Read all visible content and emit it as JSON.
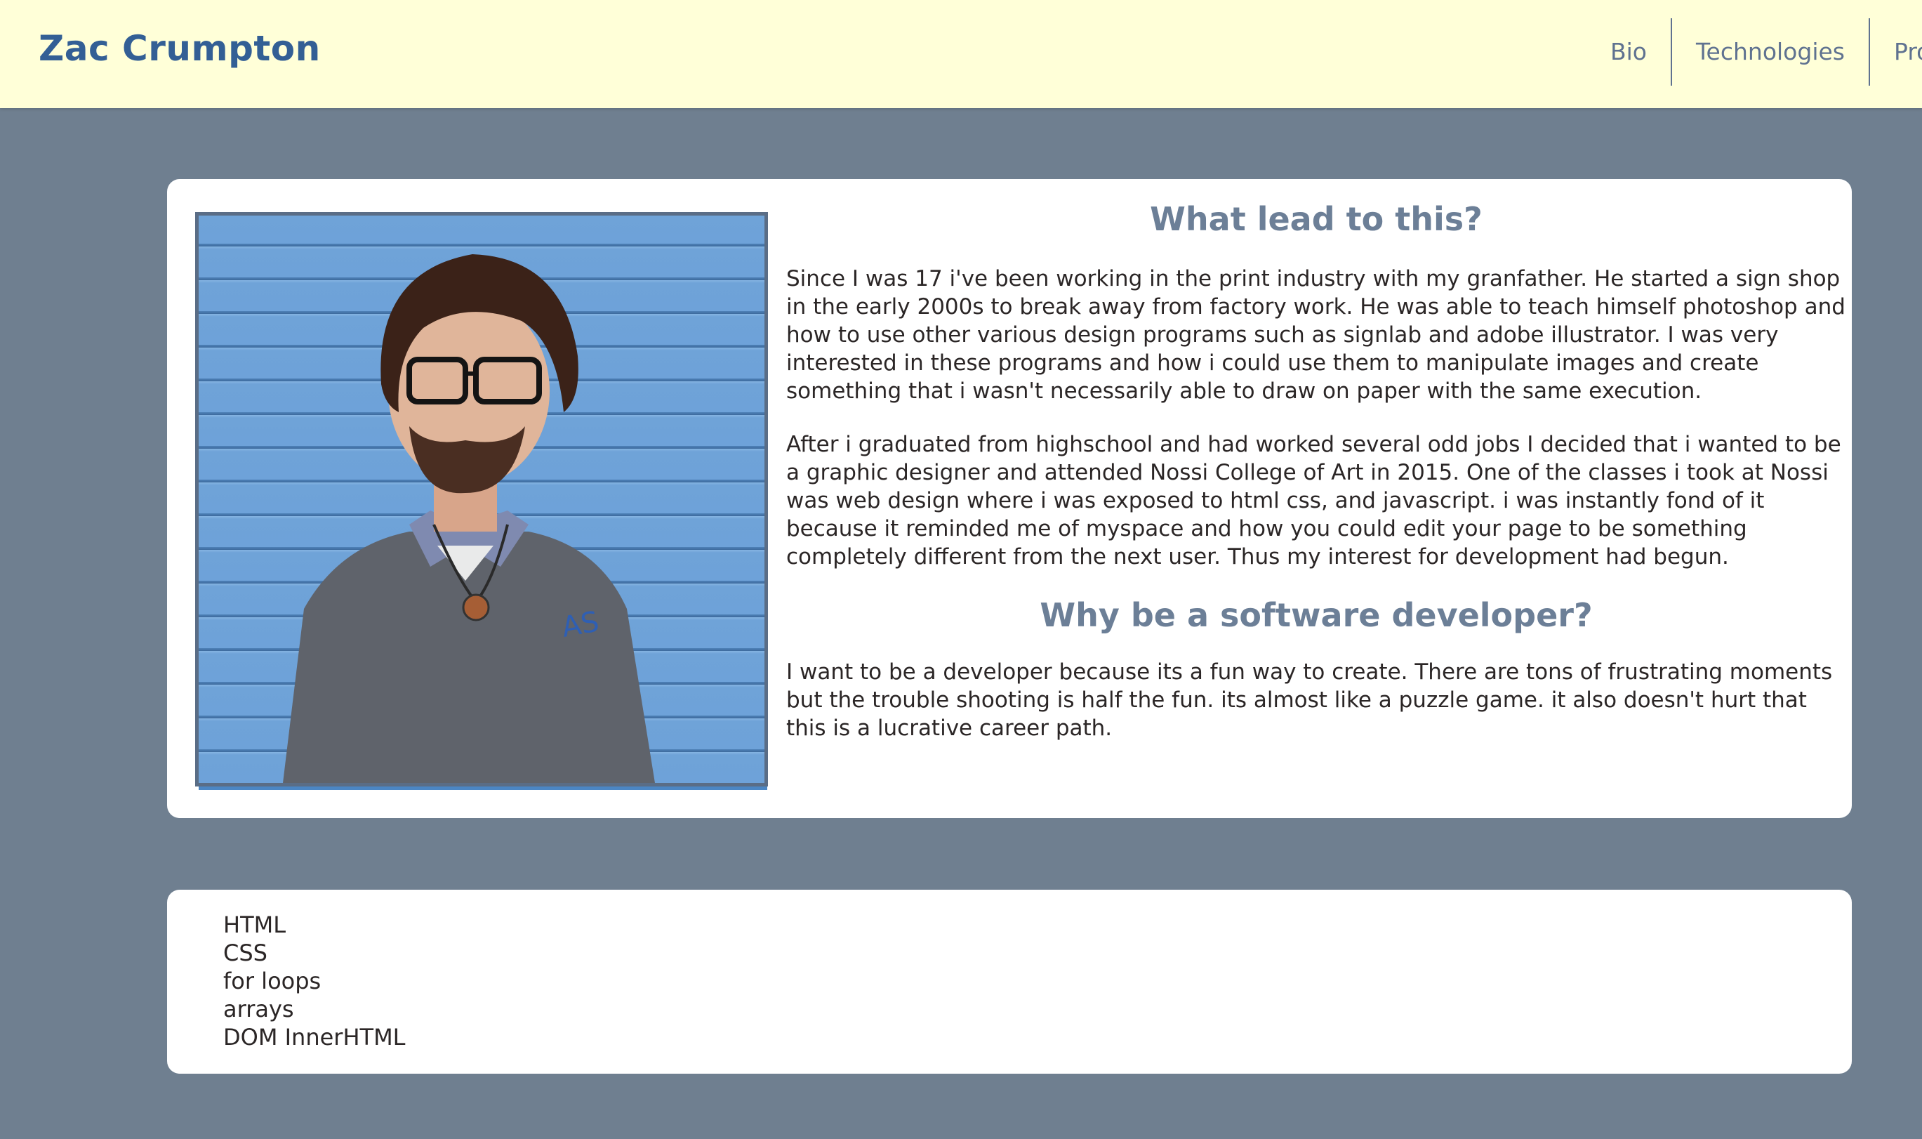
{
  "header": {
    "brand": "Zac Crumpton",
    "nav": [
      {
        "label": "Bio"
      },
      {
        "label": "Technologies"
      },
      {
        "label": "Pro"
      }
    ]
  },
  "bio": {
    "heading1": "What lead to this?",
    "paragraph1": "Since I was 17 i've been working in the print industry with my granfather. He started a sign shop in the early 2000s to break away from factory work. He was able to teach himself photoshop and how to use other various design programs such as signlab and adobe illustrator. I was very interested in these programs and how i could use them to manipulate images and create something that i wasn't necessarily able to draw on paper with the same execution.",
    "paragraph2": "After i graduated from highschool and had worked several odd jobs I decided that i wanted to be a graphic designer and attended Nossi College of Art in 2015. One of the classes i took at Nossi was web design where i was exposed to html css, and javascript. i was instantly fond of it because it reminded me of myspace and how you could edit your page to be something completely different from the next user. Thus my interest for development had begun.",
    "heading2": "Why be a software developer?",
    "paragraph3": "I want to be a developer because its a fun way to create. There are tons of frustrating moments but the trouble shooting is half the fun. its almost like a puzzle game. it also doesn't hurt that this is a lucrative career path."
  },
  "technologies": {
    "items": [
      "HTML",
      "CSS",
      "for loops",
      "arrays",
      "DOM InnerHTML"
    ]
  },
  "colors": {
    "page_bg": "#6f7f90",
    "header_bg": "#ffffd8",
    "brand": "#335f95",
    "nav_text": "#5f7290",
    "heading": "#6c7f97",
    "photo_accent": "#4b86c4"
  }
}
